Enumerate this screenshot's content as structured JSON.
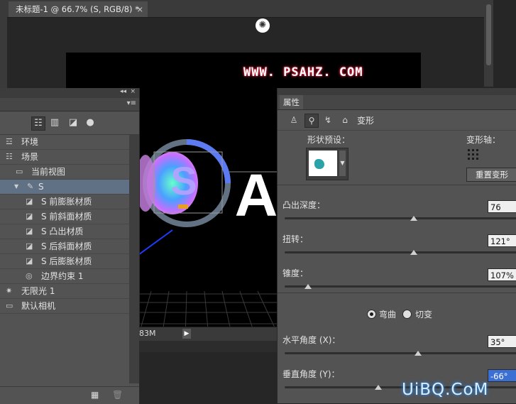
{
  "document_tab": {
    "title": "未标题-1 @ 66.7% (S, RGB/8) *",
    "close": "×"
  },
  "canvas": {
    "watermark": "WWW. PSAHZ. COM",
    "loading_icon": "spinner-icon"
  },
  "scene_panel": {
    "collapse": "◂◂",
    "close": "×",
    "menu": "▾≡",
    "items": [
      {
        "label": "环境",
        "icon": "environment-icon",
        "glyph": "☲",
        "indent": 0,
        "selected": false
      },
      {
        "label": "场景",
        "icon": "scene-icon",
        "glyph": "☷",
        "indent": 0,
        "selected": false
      },
      {
        "label": "当前视图",
        "icon": "camera-icon",
        "glyph": "▭",
        "indent": 1,
        "selected": false
      },
      {
        "label": "S",
        "icon": "mesh-icon",
        "glyph": "✎",
        "indent": 1,
        "selected": true
      },
      {
        "label": "S 前膨胀材质",
        "icon": "material-icon",
        "glyph": "◪",
        "indent": 2,
        "selected": false
      },
      {
        "label": "S 前斜面材质",
        "icon": "material-icon",
        "glyph": "◪",
        "indent": 2,
        "selected": false
      },
      {
        "label": "S 凸出材质",
        "icon": "material-icon",
        "glyph": "◪",
        "indent": 2,
        "selected": false
      },
      {
        "label": "S 后斜面材质",
        "icon": "material-icon",
        "glyph": "◪",
        "indent": 2,
        "selected": false
      },
      {
        "label": "S 后膨胀材质",
        "icon": "material-icon",
        "glyph": "◪",
        "indent": 2,
        "selected": false
      },
      {
        "label": "边界约束 1",
        "icon": "constraint-icon",
        "glyph": "◎",
        "indent": 2,
        "selected": false
      },
      {
        "label": "无限光 1",
        "icon": "infinite-light-icon",
        "glyph": "✷",
        "indent": 0,
        "selected": false
      },
      {
        "label": "默认相机",
        "icon": "camera-icon",
        "glyph": "▭",
        "indent": 0,
        "selected": false
      }
    ]
  },
  "status": {
    "memory": "83M",
    "arrow": "▶"
  },
  "properties": {
    "tab": "属性",
    "deform_label": "变形",
    "shape_preset_label": "形状预设：",
    "deform_axis_label": "变形轴：",
    "reset_button": "重置变形",
    "fields": [
      {
        "label": "凸出深度：",
        "value": "76",
        "slider": 0.55,
        "highlight": false
      },
      {
        "label": "扭转：",
        "value": "121°",
        "slider": 0.55,
        "highlight": false
      },
      {
        "label": "锥度：",
        "value": "107%",
        "slider": 0.1,
        "highlight": false
      },
      {
        "label": "水平角度 (X)：",
        "value": "35°",
        "slider": 0.57,
        "highlight": false
      },
      {
        "label": "垂直角度 (Y)：",
        "value": "-66°",
        "slider": 0.4,
        "highlight": true
      }
    ],
    "mode": {
      "option_a": "弯曲",
      "option_b": "切变",
      "selected": "弯曲"
    }
  },
  "footer_watermark": "UiBQ.CoM"
}
